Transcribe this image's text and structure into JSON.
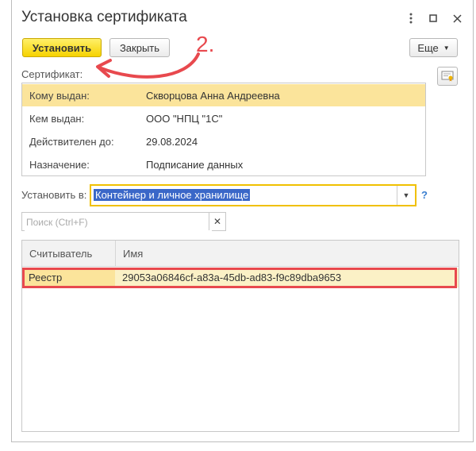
{
  "window": {
    "title": "Установка сертификата"
  },
  "toolbar": {
    "install_label": "Установить",
    "close_label": "Закрыть",
    "more_label": "Еще"
  },
  "annotation": {
    "step": "2."
  },
  "certificate": {
    "label": "Сертификат:",
    "rows": [
      {
        "key": "Кому выдан:",
        "value": "Скворцова Анна Андреевна"
      },
      {
        "key": "Кем выдан:",
        "value": "ООО \"НПЦ \"1С\""
      },
      {
        "key": "Действителен до:",
        "value": "29.08.2024"
      },
      {
        "key": "Назначение:",
        "value": "Подписание данных"
      }
    ]
  },
  "install_to": {
    "label": "Установить в:",
    "value": "Контейнер и личное хранилище",
    "help": "?"
  },
  "search": {
    "placeholder": "Поиск (Ctrl+F)",
    "value": ""
  },
  "table": {
    "columns": [
      "Считыватель",
      "Имя"
    ],
    "rows": [
      {
        "reader": "Реестр",
        "name": "29053a06846cf-a83a-45db-ad83-f9c89dba9653"
      }
    ]
  },
  "colors": {
    "accent_yellow": "#f6d200",
    "highlight": "#fbe49b",
    "selection": "#3a67c8",
    "annotation_red": "#e8494e"
  }
}
